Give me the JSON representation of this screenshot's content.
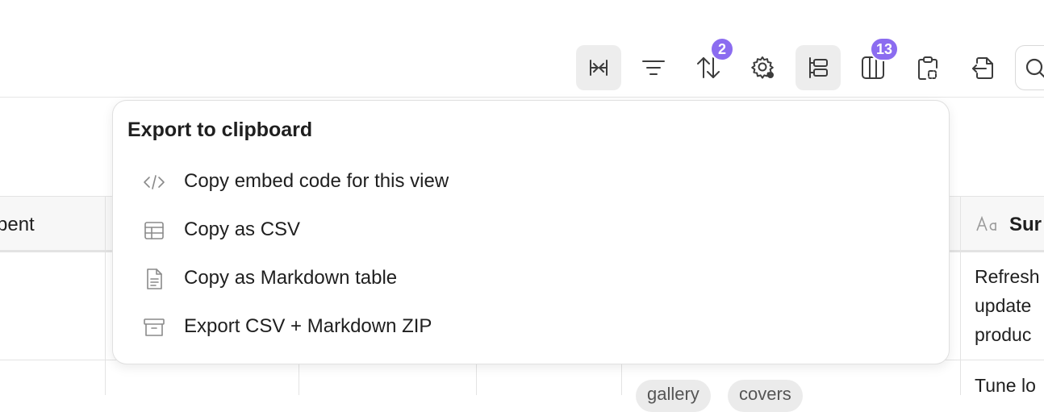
{
  "toolbar": {
    "buttons": [
      {
        "name": "collapse-columns",
        "icon": "collapse-columns-icon",
        "active": true
      },
      {
        "name": "filter",
        "icon": "filter-icon",
        "active": false
      },
      {
        "name": "sort",
        "icon": "sort-icon",
        "active": false,
        "badge": "2"
      },
      {
        "name": "settings",
        "icon": "gear-icon",
        "active": false
      },
      {
        "name": "group",
        "icon": "group-icon",
        "active": true
      },
      {
        "name": "columns",
        "icon": "columns-icon",
        "active": false,
        "badge": "13"
      },
      {
        "name": "export-clipboard",
        "icon": "clipboard-icon",
        "active": false
      },
      {
        "name": "import",
        "icon": "file-import-icon",
        "active": false
      }
    ],
    "badge_color": "#8b6cf0"
  },
  "popover": {
    "title": "Export to clipboard",
    "items": [
      {
        "label": "Copy embed code for this view",
        "icon": "code-icon"
      },
      {
        "label": "Copy as CSV",
        "icon": "table-icon"
      },
      {
        "label": "Copy as Markdown table",
        "icon": "document-icon"
      },
      {
        "label": "Export CSV + Markdown ZIP",
        "icon": "archive-icon"
      }
    ]
  },
  "table": {
    "headers": {
      "col1": "pent",
      "last": "Sur"
    },
    "last_col_icon": "text-type-icon",
    "rows": [
      {
        "last": [
          "Refresh",
          "update",
          "produc"
        ]
      },
      {
        "last": [
          "Tune lo"
        ],
        "tags": [
          "gallery",
          "covers"
        ]
      }
    ]
  }
}
